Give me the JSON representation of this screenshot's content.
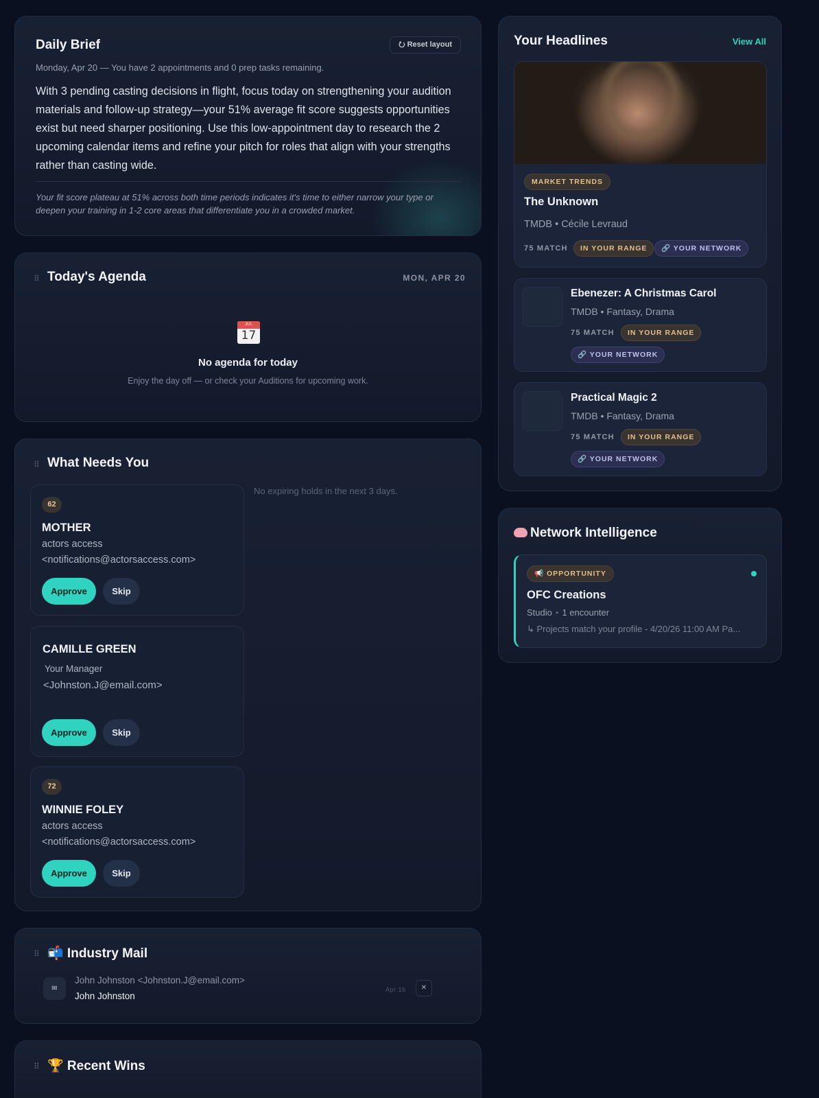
{
  "daily_brief": {
    "title": "Daily Brief",
    "reset_label": "⭮ Reset layout",
    "subtitle": "Monday, Apr 20 — You have 2 appointments and 0 prep tasks remaining.",
    "body": "With 3 pending casting decisions in flight, focus today on strengthening your audition materials and follow-up strategy—your 51% average fit score suggests opportunities exist but need sharper positioning. Use this low-appointment day to research the 2 upcoming calendar items and refine your pitch for roles that align with your strengths rather than casting wide.",
    "note": "Your fit score plateau at 51% across both time periods indicates it's time to either narrow your type or deepen your training in 1-2 core areas that differentiate you in a crowded market."
  },
  "agenda": {
    "drag": "⠿",
    "title": "Today's Agenda",
    "date": "MON, APR 20",
    "calendar_month": "JUL",
    "calendar_day": "17",
    "empty_title": "No agenda for today",
    "empty_sub": "Enjoy the day off — or check your Auditions for upcoming work."
  },
  "needs": {
    "drag": "⠿",
    "title": "What Needs You",
    "no_holds": "No expiring holds in the next 3 days.",
    "items": [
      {
        "score": "62",
        "name": "MOTHER",
        "line1": "actors access",
        "line2": "<notifications@actorsaccess.com>",
        "approve": "Approve",
        "skip": "Skip"
      },
      {
        "score": "",
        "name": "CAMILLE GREEN",
        "line1": "Your Manager",
        "line2": "<Johnston.J@email.com>",
        "approve": "Approve",
        "skip": "Skip"
      },
      {
        "score": "72",
        "name": "WINNIE FOLEY",
        "line1": "actors access",
        "line2": "<notifications@actorsaccess.com>",
        "approve": "Approve",
        "skip": "Skip"
      }
    ]
  },
  "mail": {
    "drag": "⠿",
    "title": "📬 Industry Mail",
    "items": [
      {
        "icon": "✉",
        "from": "John Johnston <Johnston.J@email.com>",
        "subject": "John Johnston",
        "date": "Apr 16",
        "dismiss": "✕"
      }
    ]
  },
  "wins": {
    "drag": "⠿",
    "title": "🏆 Recent Wins"
  },
  "headlines": {
    "title": "Your Headlines",
    "view_all": "View All",
    "featured": {
      "tag": "MARKET TRENDS",
      "title": "The Unknown",
      "meta": "TMDB • Cécile Levraud",
      "match": "75 MATCH",
      "range": "IN YOUR RANGE",
      "network": "🔗 YOUR NETWORK"
    },
    "items": [
      {
        "title": "Ebenezer: A Christmas Carol",
        "meta": "TMDB • Fantasy, Drama",
        "match": "75 MATCH",
        "range": "IN YOUR RANGE",
        "network": "🔗 YOUR NETWORK"
      },
      {
        "title": "Practical Magic 2",
        "meta": "TMDB • Fantasy, Drama",
        "match": "75 MATCH",
        "range": "IN YOUR RANGE",
        "network": "🔗 YOUR NETWORK"
      }
    ]
  },
  "network": {
    "title": "Network Intelligence",
    "tag": "📢 OPPORTUNITY",
    "name": "OFC Creations",
    "type": "Studio",
    "encounters": "1 encounter",
    "detail": "↳ Projects match your profile - 4/20/26 11:00 AM Pa..."
  },
  "colors": {
    "accent": "#2fd3c0",
    "background": "#0b1020",
    "card": "#182033",
    "warm_tag": "#e2bf8b",
    "network_tag": "#bfc2ee"
  }
}
